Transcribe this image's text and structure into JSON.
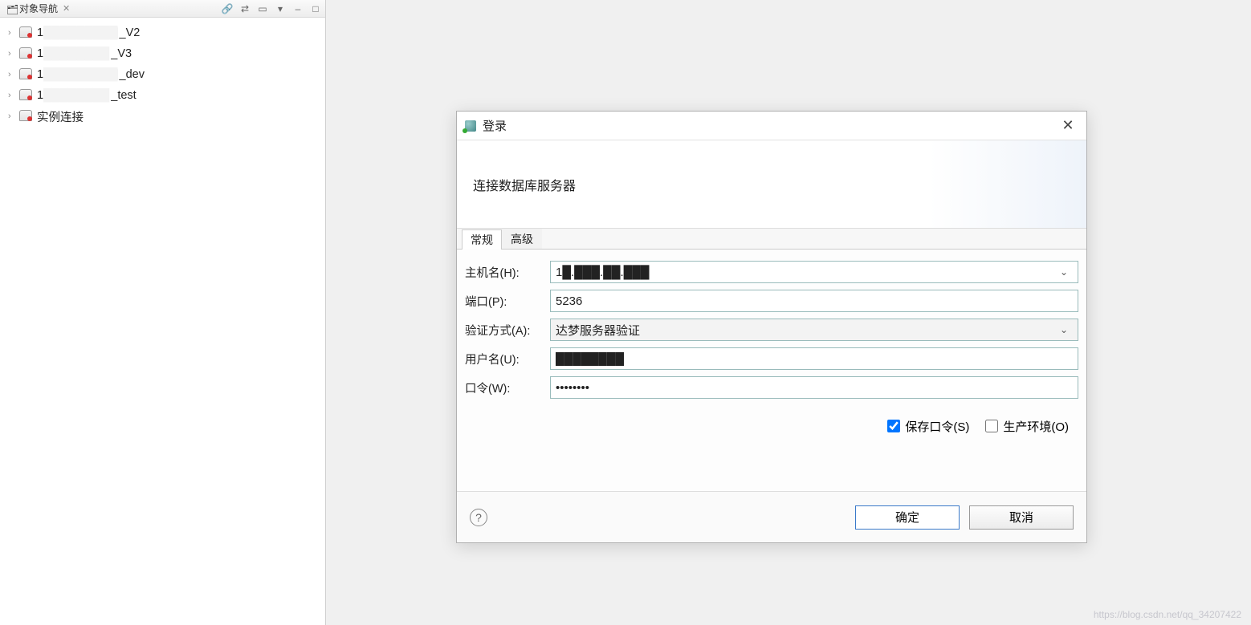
{
  "sidebar": {
    "title": "对象导航",
    "items": [
      {
        "prefix": "1",
        "obscured": "█████████",
        "suffix": "_V2"
      },
      {
        "prefix": "1",
        "obscured": "████████",
        "suffix": "_V3"
      },
      {
        "prefix": "1",
        "obscured": "█████████",
        "suffix": "_dev"
      },
      {
        "prefix": "1",
        "obscured": "████████",
        "suffix": "_test"
      },
      {
        "prefix": "",
        "obscured": "",
        "suffix": "实例连接"
      }
    ]
  },
  "dialog": {
    "title": "登录",
    "banner": "连接数据库服务器",
    "tabs": {
      "general": "常规",
      "advanced": "高级",
      "active": "general"
    },
    "form": {
      "host_label": "主机名(H):",
      "host_value": "1█.███.██.███",
      "port_label": "端口(P):",
      "port_value": "5236",
      "auth_label": "验证方式(A):",
      "auth_value": "达梦服务器验证",
      "user_label": "用户名(U):",
      "user_value": "████████",
      "pwd_label": "口令(W):",
      "pwd_value": "●●●●●●●●",
      "save_pwd_label": "保存口令(S)",
      "save_pwd_checked": true,
      "prod_env_label": "生产环境(O)",
      "prod_env_checked": false
    },
    "buttons": {
      "ok": "确定",
      "cancel": "取消"
    }
  },
  "watermark": "https://blog.csdn.net/qq_34207422"
}
